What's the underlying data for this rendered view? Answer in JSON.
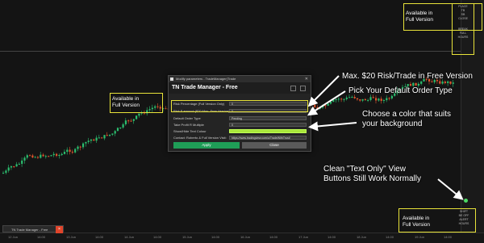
{
  "dialog": {
    "window_title": "Modify parameters - TradeManager(Trade",
    "header_title": "TN Trade Manager - Free",
    "rows": [
      {
        "label": "Risk Percentage (Full Version Only)",
        "value": "0"
      },
      {
        "label": "Risk $ amount ($20 Max. Free Version)",
        "value": "0"
      },
      {
        "label": "Default Order Type",
        "value": "Pending"
      },
      {
        "label": "Take Profit R Multiple",
        "value": "0"
      },
      {
        "label": "Show/Hide Text Colour",
        "value": ""
      },
      {
        "label": "Contact: Roberto & Full Version Visit:",
        "value": "https://www.tradingview.com/u/TradeWithTrust/"
      }
    ],
    "apply_label": "Apply",
    "close_label": "Close",
    "close_icon": "x-icon",
    "maximize_icon": "square-icon"
  },
  "annotations": {
    "max_risk": "Max. $20 Risk/Trade in Free Version",
    "order_type": "Pick Your Default Order Type",
    "color_choice": [
      "Choose a color that suits",
      "your background"
    ],
    "text_only": [
      "Clean \"Text Only\" View",
      "Buttons Still Work Normally"
    ],
    "available_top": [
      "Available in",
      "Full Version"
    ],
    "available_dialog": [
      "Available in",
      "Full Version"
    ],
    "available_bottom": [
      "Available in",
      "Full Version"
    ]
  },
  "panels": {
    "top_right": {
      "title": "PLACE",
      "buttons": [
        "TB",
        "SB"
      ],
      "label": "CLOSE",
      "sub": [
        "BREAK",
        "FULL",
        "HOURS"
      ]
    },
    "bottom_right": {
      "title": "SHIFT",
      "buttons": [
        "BE OFF",
        "ALERT"
      ],
      "label": "HOURS"
    }
  },
  "taskbar": {
    "item_label": "TN Trade Manager - Free",
    "close_icon": "x-icon"
  },
  "time_axis": {
    "labels": [
      "12 Jun",
      "14:00",
      "13 Jun",
      "14:00",
      "14 Jun",
      "14:00",
      "15 Jun",
      "14:00",
      "16 Jun",
      "14:00",
      "17 Jun",
      "14:00",
      "18 Jun",
      "14:00",
      "19 Jun",
      "14:00"
    ]
  },
  "colors": {
    "up": "#2bbd6e",
    "down": "#e0552e",
    "accent": "#e8e33a",
    "swatch": "#a8e63c",
    "apply": "#1f9e57"
  }
}
